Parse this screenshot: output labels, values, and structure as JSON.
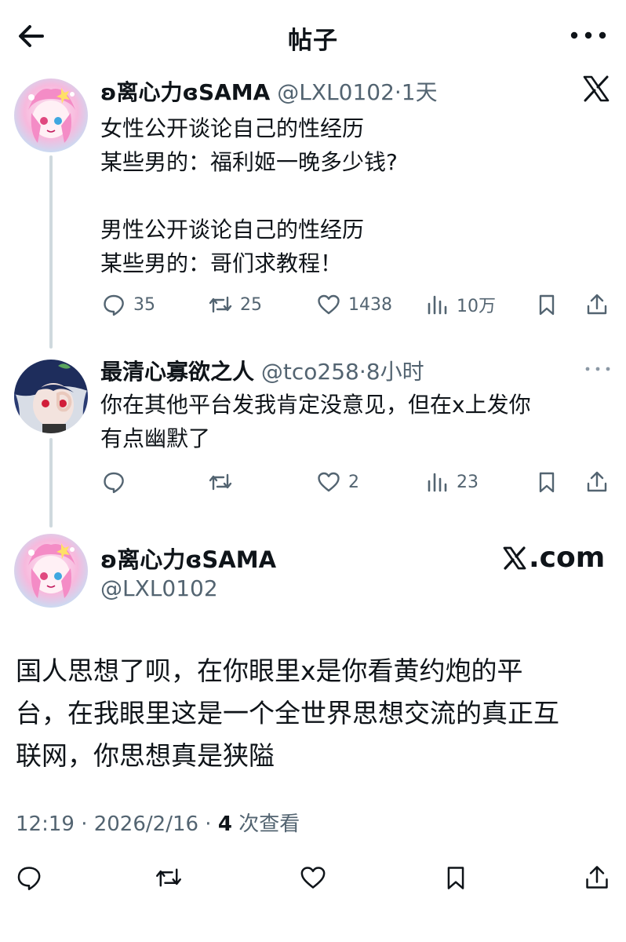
{
  "header": {
    "title": "帖子"
  },
  "tweets": [
    {
      "name": "ʚ离心力ɞSAMA",
      "handle": "@LXL0102",
      "time": "1天",
      "text": "女性公开谈论自己的性经历\n某些男的：福利姬一晚多少钱?\n\n男性公开谈论自己的性经历\n某些男的：哥们求教程！",
      "replies": "35",
      "reposts": "25",
      "likes": "1438",
      "views": "10万"
    },
    {
      "name": "最清心寡欲之人",
      "handle": "@tco258",
      "time": "8小时",
      "text": "你在其他平台发我肯定没意见，但在x上发你\n有点幽默了",
      "replies": "",
      "reposts": "",
      "likes": "2",
      "views": "23"
    }
  ],
  "main": {
    "name": "ʚ离心力ɞSAMA",
    "handle": "@LXL0102",
    "brand": ".com",
    "text": "国人思想了呗，在你眼里x是你看黄约炮的平\n台，在我眼里这是一个全世界思想交流的真正互\n联网，你思想真是狭隘",
    "timestamp": "12:19 · 2026/2/16 · ",
    "views_count": "4",
    "views_label": " 次查看"
  },
  "icons": {
    "back": "arrow-left-icon",
    "more": "more-horizontal-icon",
    "reply": "reply-bubble-icon",
    "repost": "repost-icon",
    "like": "heart-icon",
    "views": "views-bar-chart-icon",
    "bookmark": "bookmark-icon",
    "share": "share-upload-icon",
    "x": "x-logo-icon"
  },
  "colors": {
    "text": "#0f1419",
    "secondary": "#536471",
    "thread_line": "#cfd9de"
  }
}
